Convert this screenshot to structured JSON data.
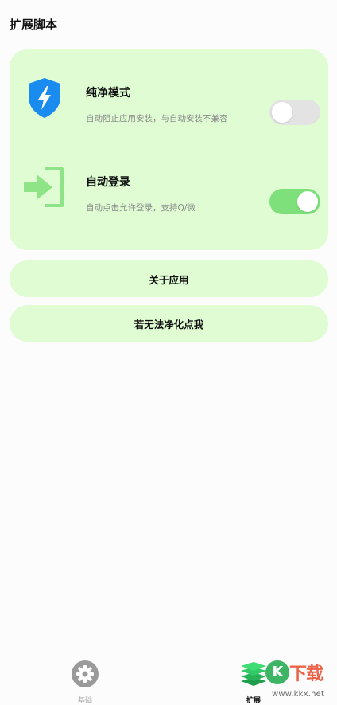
{
  "header": {
    "title": "扩展脚本"
  },
  "settings": [
    {
      "title": "纯净模式",
      "description": "自动阻止应用安装，与自动安装不兼容",
      "icon": "shield-lightning-icon",
      "enabled": false
    },
    {
      "title": "自动登录",
      "description": "自动点击允许登录，支持Q/微",
      "icon": "login-arrow-icon",
      "enabled": true
    }
  ],
  "buttons": {
    "about": "关于应用",
    "fix": "若无法净化点我"
  },
  "bottom_nav": {
    "items": [
      {
        "label": "基础",
        "icon": "gear-icon",
        "active": false
      },
      {
        "label": "扩展",
        "icon": "layers-icon",
        "active": true
      }
    ]
  },
  "watermark": {
    "logo_letter": "K",
    "logo_text": "下载",
    "url": "www.kkx.net"
  },
  "colors": {
    "card_bg": "#dffcd3",
    "toggle_on": "#7ee07a",
    "toggle_off": "#e3e3e3",
    "shield_blue": "#1a8cf0",
    "login_green": "#8ee486",
    "active_nav_green": "#2ec260"
  }
}
